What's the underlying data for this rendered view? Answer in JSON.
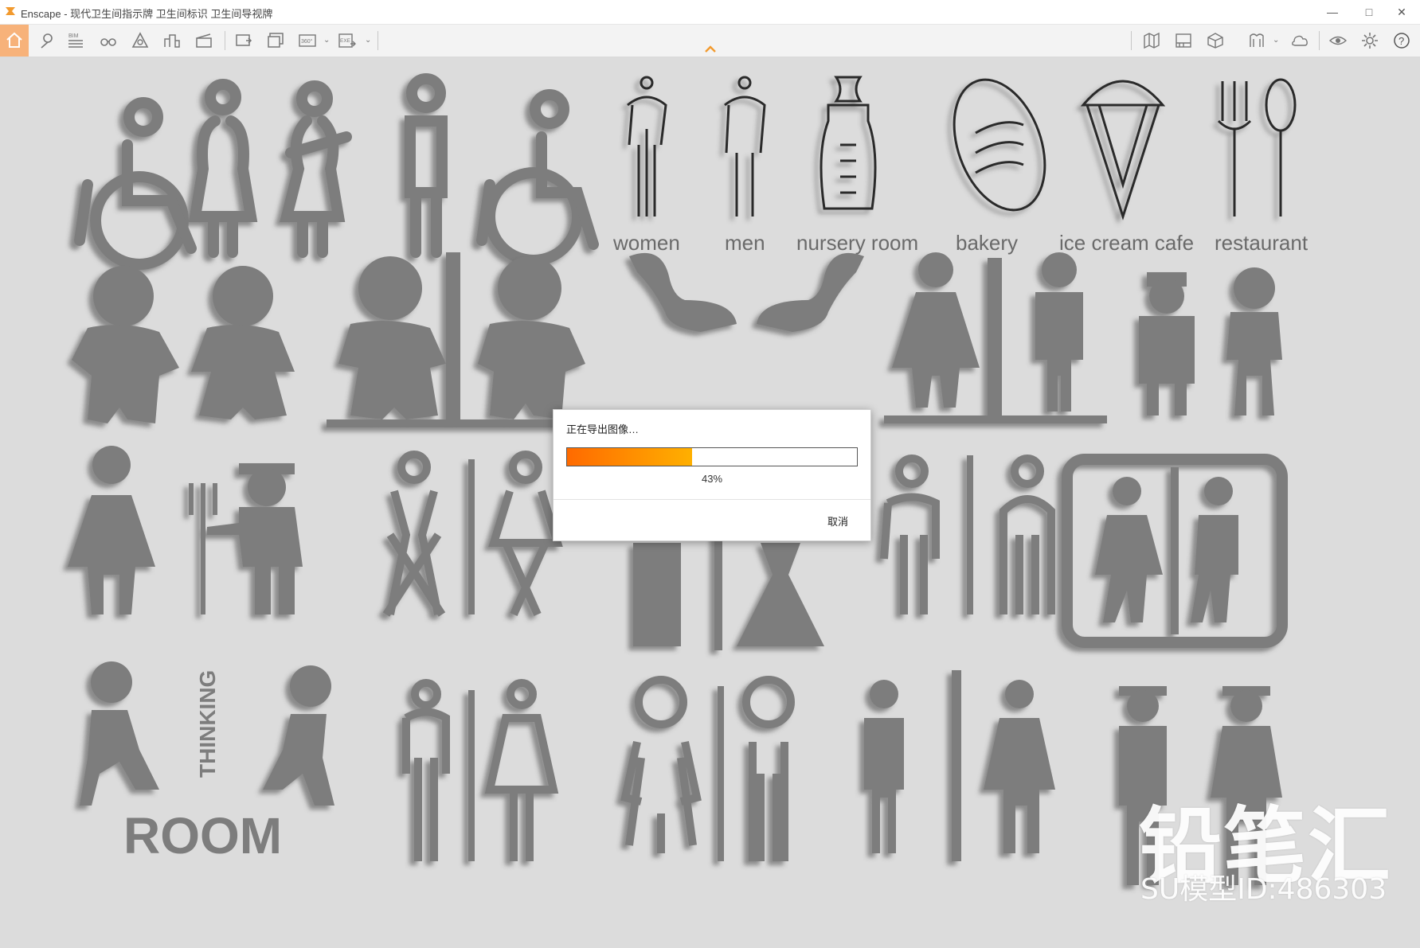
{
  "window": {
    "title": "Enscape - 现代卫生间指示牌 卫生间标识 卫生间导视牌",
    "minimize_glyph": "—",
    "maximize_glyph": "□",
    "close_glyph": "✕"
  },
  "toolbar": {
    "left_icons": [
      "home-icon",
      "location-pin-icon",
      "bim-icon",
      "binoculars-icon",
      "site-context-icon",
      "assets-icon",
      "clapperboard-icon",
      "screenshot-icon",
      "batch-render-icon",
      "panorama-360-icon",
      "exe-export-icon"
    ],
    "bim_label": "BIM",
    "pano_label": "360°",
    "exe_label": "EXE",
    "right_icons": [
      "map-icon",
      "video-editor-icon",
      "view-cube-icon",
      "material-editor-icon",
      "cloud-upload-icon",
      "visual-settings-icon",
      "settings-gear-icon",
      "help-icon"
    ],
    "help_glyph": "?",
    "dropdown_glyph": "⌄"
  },
  "scene": {
    "labels": [
      "women",
      "men",
      "nursery room",
      "bakery",
      "ice cream cafe",
      "restaurant"
    ],
    "thinking_text": "THINKING",
    "room_text": "ROOM"
  },
  "dialog": {
    "title": "正在导出图像…",
    "progress": 0.43,
    "percent_text": "43%",
    "cancel_label": "取消",
    "progress_colors": [
      "#ff6a00",
      "#ffb000"
    ]
  },
  "watermark": {
    "brand": "铅笔汇",
    "model_id": "SU模型ID:486303"
  },
  "colors": {
    "accent": "#f7b27a",
    "sign_gray": "#7d7d7d",
    "background": "#dcdcdc"
  }
}
